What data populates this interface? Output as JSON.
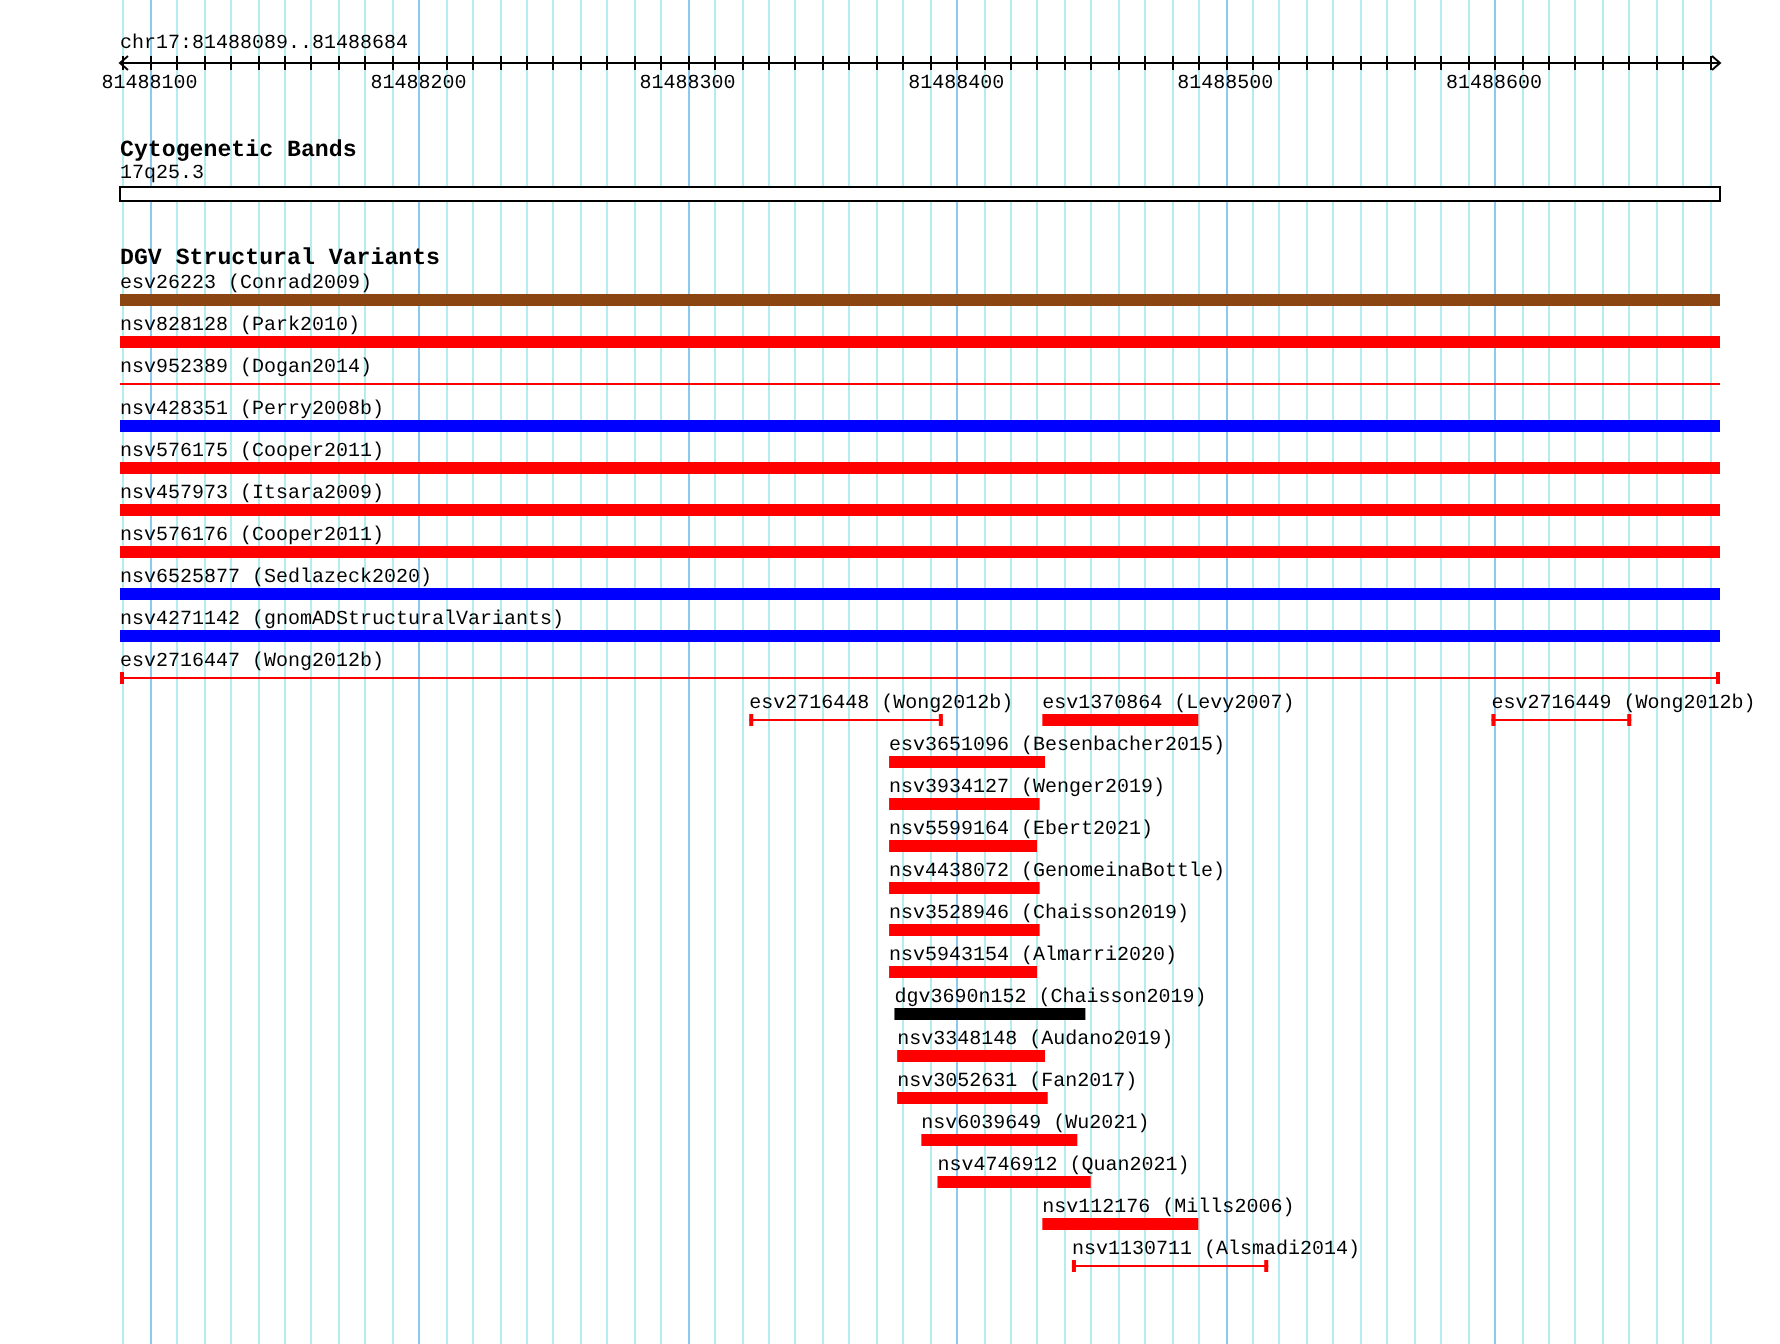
{
  "location": "chr17:81488089..81488684",
  "ruler": {
    "ticks": [
      "81488100",
      "81488200",
      "81488300",
      "81488400",
      "81488500",
      "81488600"
    ]
  },
  "tracks": [
    {
      "kind": "cytoband",
      "title": "Cytogenetic Bands",
      "band": {
        "name": "17q25.3"
      }
    },
    {
      "kind": "features",
      "title": "DGV Structural Variants",
      "rows": [
        [
          {
            "label": "esv26223 (Conrad2009)",
            "kind": "thick",
            "color": "#8b4513"
          }
        ],
        [
          {
            "label": "nsv828128 (Park2010)",
            "kind": "thick",
            "color": "#ff0000"
          }
        ],
        [
          {
            "label": "nsv952389 (Dogan2014)",
            "kind": "line",
            "color": "#ff0000"
          }
        ],
        [
          {
            "label": "nsv428351 (Perry2008b)",
            "kind": "thick",
            "color": "#0000ff"
          }
        ],
        [
          {
            "label": "nsv576175 (Cooper2011)",
            "kind": "thick",
            "color": "#ff0000"
          }
        ],
        [
          {
            "label": "nsv457973 (Itsara2009)",
            "kind": "thick",
            "color": "#ff0000"
          }
        ],
        [
          {
            "label": "nsv576176 (Cooper2011)",
            "kind": "thick",
            "color": "#ff0000"
          }
        ],
        [
          {
            "label": "nsv6525877 (Sedlazeck2020)",
            "kind": "thick",
            "color": "#0000ff"
          }
        ],
        [
          {
            "label": "nsv4271142 (gnomADStructuralVariants)",
            "kind": "thick",
            "color": "#0000ff"
          }
        ],
        [
          {
            "label": "esv2716447 (Wong2012b)",
            "kind": "capped",
            "color": "#ff0000"
          }
        ],
        [
          {
            "label": "esv2716448 (Wong2012b)",
            "kind": "capped",
            "color": "#ff0000"
          },
          {
            "label": "esv1370864 (Levy2007)",
            "kind": "thick",
            "color": "#ff0000"
          },
          {
            "label": "esv2716449 (Wong2012b)",
            "kind": "capped",
            "color": "#ff0000"
          }
        ],
        [
          {
            "label": "esv3651096 (Besenbacher2015)",
            "kind": "thick",
            "color": "#ff0000"
          }
        ],
        [
          {
            "label": "nsv3934127 (Wenger2019)",
            "kind": "thick",
            "color": "#ff0000"
          }
        ],
        [
          {
            "label": "nsv5599164 (Ebert2021)",
            "kind": "thick",
            "color": "#ff0000"
          }
        ],
        [
          {
            "label": "nsv4438072 (GenomeinaBottle)",
            "kind": "thick",
            "color": "#ff0000"
          }
        ],
        [
          {
            "label": "nsv3528946 (Chaisson2019)",
            "kind": "thick",
            "color": "#ff0000"
          }
        ],
        [
          {
            "label": "nsv5943154 (Almarri2020)",
            "kind": "thick",
            "color": "#ff0000"
          }
        ],
        [
          {
            "label": "dgv3690n152 (Chaisson2019)",
            "kind": "thick",
            "color": "#000000"
          }
        ],
        [
          {
            "label": "nsv3348148 (Audano2019)",
            "kind": "thick",
            "color": "#ff0000"
          }
        ],
        [
          {
            "label": "nsv3052631 (Fan2017)",
            "kind": "thick",
            "color": "#ff0000"
          }
        ],
        [
          {
            "label": "nsv6039649 (Wu2021)",
            "kind": "thick",
            "color": "#ff0000"
          }
        ],
        [
          {
            "label": "nsv4746912 (Quan2021)",
            "kind": "thick",
            "color": "#ff0000"
          }
        ],
        [
          {
            "label": "nsv112176 (Mills2006)",
            "kind": "thick",
            "color": "#ff0000"
          }
        ],
        [
          {
            "label": "nsv1130711 (Alsmadi2014)",
            "kind": "capped",
            "color": "#ff0000"
          }
        ]
      ]
    }
  ]
}
